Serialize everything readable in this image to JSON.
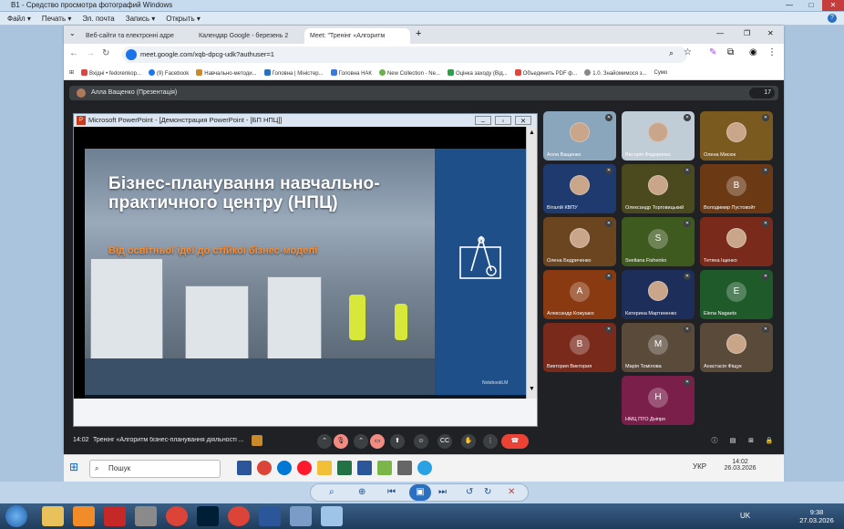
{
  "viewer": {
    "title": "B1 - Средство просмотра фотографий Windows",
    "menu": [
      "Файл ▾",
      "Печать ▾",
      "Эл. почта",
      "Запись ▾",
      "Открыть ▾"
    ]
  },
  "chrome": {
    "tabs": [
      "Веб-сайти та електронні адре",
      "Календар Google - березень 2",
      "Meet: \"Тренінг «Алгоритм"
    ],
    "url": "meet.google.com/xqb-dpcg-udk?authuser=1",
    "bookmarks": [
      "Вхідні • fedorenkop...",
      "(9) Facebook",
      "Навчально-методи...",
      "Головна | Міністер...",
      "Головна НАК",
      "New Collection - Ne...",
      "Оцінка заходу (Від...",
      "Объединить PDF ф...",
      "1.0. Знайомимося з...",
      "Сумо"
    ]
  },
  "meet": {
    "presenter": "Алла Ващенко (Презентація)",
    "participants_count": "17",
    "ppt_title": "Microsoft PowerPoint - [Демонстрация PowerPoint - [БП НПЦ]]",
    "slide": {
      "title": "Бізнес-планування навчально-практичного центру (НПЦ)",
      "subtitle": "Від освітньої ідеї до стійкої бізнес-моделі",
      "badge": "NotebookLM"
    },
    "tiles": [
      {
        "name": "Алла Ващенко",
        "initial": "",
        "color": "#8aa6bd"
      },
      {
        "name": "Вікторія Федоренко",
        "initial": "",
        "color": "#c0ccd6"
      },
      {
        "name": "Олена Мисюк",
        "initial": "",
        "color": "#7a5a1e"
      },
      {
        "name": "Віталій КВПУ",
        "initial": "",
        "color": "#1e3a6e"
      },
      {
        "name": "Олександр Торговицький",
        "initial": "",
        "color": "#4a4a1e"
      },
      {
        "name": "Володимир Пустовойт",
        "initial": "В",
        "color": "#6b3a14"
      },
      {
        "name": "Олена Бедриченко",
        "initial": "",
        "color": "#6b4520"
      },
      {
        "name": "Svetlana Fishenko",
        "initial": "S",
        "color": "#3f5a1f"
      },
      {
        "name": "Тетяна Іщенко",
        "initial": "",
        "color": "#7a2a1a"
      },
      {
        "name": "Александр Кожушко",
        "initial": "А",
        "color": "#8a3a10"
      },
      {
        "name": "Катерина Мартиненко",
        "initial": "",
        "color": "#1e2e5a"
      },
      {
        "name": "Elena Nagaets",
        "initial": "E",
        "color": "#1e5a2a"
      },
      {
        "name": "Виктория Виктория",
        "initial": "В",
        "color": "#7a2a1a"
      },
      {
        "name": "Марія Томілова",
        "initial": "М",
        "color": "#5a4a3a"
      },
      {
        "name": "Анастасія Фіщук",
        "initial": "",
        "color": "#5a4a3a"
      },
      {
        "name": "НМЦ ПТО Дніпро",
        "initial": "Н",
        "color": "#7a1e4a"
      }
    ],
    "time": "14:02",
    "meeting_name": "Тренінг «Алгоритм бізнес-планування діяльності ..."
  },
  "taskbar_inner": {
    "search": "Пошук",
    "lang": "УКР",
    "time": "14:02",
    "date": "26.03.2026"
  },
  "taskbar_outer": {
    "lang": "UK",
    "time": "9:38",
    "date": "27.03.2026"
  }
}
